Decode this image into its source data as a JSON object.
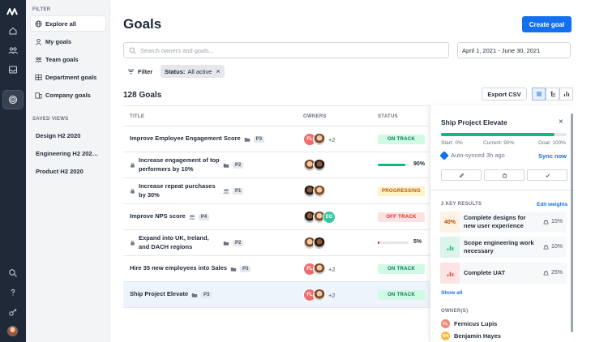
{
  "colors": {
    "accent": "#1570ef",
    "on_track": "#047857",
    "progressing": "#b45309",
    "off_track": "#dc2626",
    "progress_green": "#10b981"
  },
  "rail": {
    "icons": [
      "logo-icon",
      "home-icon",
      "people-icon",
      "inbox-icon",
      "goals-icon",
      "search-icon",
      "help-icon",
      "key-icon"
    ]
  },
  "sidebar": {
    "filter_heading": "FILTER",
    "items": [
      {
        "label": "Explore all",
        "icon": "globe-icon"
      },
      {
        "label": "My goals",
        "icon": "user-icon"
      },
      {
        "label": "Team goals",
        "icon": "team-icon"
      },
      {
        "label": "Department goals",
        "icon": "department-icon"
      },
      {
        "label": "Company goals",
        "icon": "building-icon"
      }
    ],
    "saved_heading": "SAVED VIEWS",
    "saved": [
      "Design H2 2020",
      "Engineering H2 202…",
      "Product H2 2020"
    ]
  },
  "header": {
    "title": "Goals",
    "create_label": "Create goal",
    "search_placeholder": "Search owners and goals...",
    "date_range": "April 1, 2021 - June 30, 2021",
    "filter_label": "Filter",
    "chip_key": "Status:",
    "chip_value": "All active",
    "chip_close": "×"
  },
  "toolbar": {
    "count": "128 Goals",
    "export_label": "Export CSV"
  },
  "table": {
    "headers": {
      "title": "TITLE",
      "owners": "OWNERS",
      "status": "STATUS"
    },
    "rows": [
      {
        "title": "Improve Employee Engagement Score",
        "locked": false,
        "prio": "P3",
        "owners": [
          {
            "i": "FL",
            "c": "#f06d6d"
          },
          {
            "i": "",
            "c": "photo"
          }
        ],
        "more": "+2",
        "status": "ON TRACK",
        "kind": "ontrack"
      },
      {
        "title": "Increase engagement of top performers by 10%",
        "locked": true,
        "prio": "P2",
        "owners": [
          {
            "i": "",
            "c": "photo"
          },
          {
            "i": "",
            "c": "photo2"
          }
        ],
        "more": "",
        "progress": 0.9,
        "pct": "90%",
        "kind": "progress"
      },
      {
        "title": "Increase repeat purchases by 30%",
        "locked": true,
        "prio": "P1",
        "owners": [
          {
            "i": "",
            "c": "photo2"
          },
          {
            "i": "",
            "c": "photo"
          }
        ],
        "more": "",
        "status": "PROGRESSING",
        "kind": "progressing"
      },
      {
        "title": "Improve NPS score",
        "locked": false,
        "prio": "P4",
        "owners": [
          {
            "i": "",
            "c": "photo2"
          },
          {
            "i": "",
            "c": "photo"
          },
          {
            "i": "EG",
            "c": "#34c7a1"
          }
        ],
        "more": "",
        "status": "OFF TRACK",
        "kind": "offtrack"
      },
      {
        "title": "Expand into UK, Ireland, and DACH regions",
        "locked": true,
        "prio": "P2",
        "owners": [
          {
            "i": "",
            "c": "photo"
          },
          {
            "i": "",
            "c": "photo2"
          }
        ],
        "more": "",
        "progress": 0.05,
        "pct": "5%",
        "kind": "progress"
      },
      {
        "title": "Hire 35 new employees into Sales",
        "locked": false,
        "prio": "P3",
        "owners": [
          {
            "i": "FL",
            "c": "#f06d6d"
          },
          {
            "i": "",
            "c": "photo"
          }
        ],
        "more": "+2",
        "status": "ON TRACK",
        "kind": "ontrack"
      },
      {
        "title": "Ship Project Elevate",
        "locked": false,
        "prio": "P3",
        "owners": [
          {
            "i": "FL",
            "c": "#f06d6d"
          },
          {
            "i": "",
            "c": "photo"
          }
        ],
        "more": "+2",
        "status": "ON TRACK",
        "kind": "ontrack",
        "selected": true
      }
    ]
  },
  "panel": {
    "title": "Ship Project Elevate",
    "close": "×",
    "progress": 0.9,
    "start": "Start: 0%",
    "current": "Current: 90%",
    "goal": "Goal: 100%",
    "synced": "Auto-synced 3h ago",
    "sync_now": "Sync now",
    "kr_heading": "3 KEY RESULTS",
    "edit_weights": "Edit weights",
    "key_results": [
      {
        "badge": "40%",
        "badge_bg": "#fdf3e3",
        "badge_color": "#b45309",
        "text": "Complete designs for new user experience",
        "weight": "15%"
      },
      {
        "badge": "bars-green",
        "badge_bg": "#dcf5ea",
        "badge_color": "#10b981",
        "text": "Scope engineering work necessary",
        "weight": "10%"
      },
      {
        "badge": "bars-red",
        "badge_bg": "#fde4e4",
        "badge_color": "#ef4444",
        "text": "Complete UAT",
        "weight": "25%"
      }
    ],
    "show_all": "Show all",
    "owners_heading": "OWNER(S)",
    "owners": [
      {
        "initials": "FL",
        "name": "Fernicus Lupis",
        "color": "#f08a7a"
      },
      {
        "initials": "BH",
        "name": "Benjamin Hayes",
        "color": "#f5b942"
      }
    ]
  }
}
